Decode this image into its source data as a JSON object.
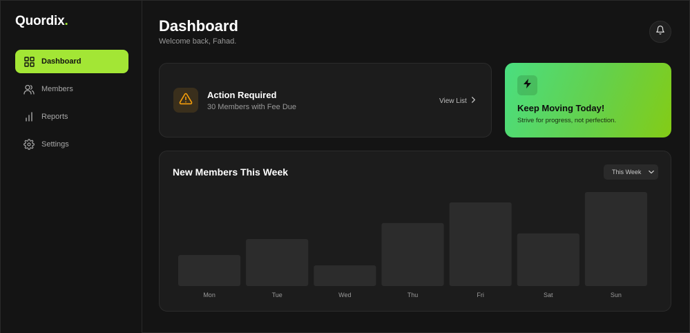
{
  "sidebar": {
    "logo": "Quordix",
    "logo_dot": ".",
    "items": [
      {
        "label": "Dashboard",
        "icon": "grid-icon",
        "active": true
      },
      {
        "label": "Members",
        "icon": "users-icon",
        "active": false
      },
      {
        "label": "Reports",
        "icon": "bar-chart-icon",
        "active": false
      },
      {
        "label": "Settings",
        "icon": "gear-icon",
        "active": false
      }
    ]
  },
  "header": {
    "title": "Dashboard",
    "subtitle": "Welcome back, Fahad.",
    "bell_icon": "bell-icon"
  },
  "action_card": {
    "title": "Action Required",
    "subtitle": "30 Members with Fee Due",
    "link": "View List",
    "icon": "warning-icon",
    "accent": "#f59e0b"
  },
  "motivation_card": {
    "title": "Keep Moving Today!",
    "subtitle": "Strive for progress, not perfection.",
    "icon": "bolt-icon"
  },
  "chart_card": {
    "title": "New Members This Week",
    "period": "This Week"
  },
  "chart_data": {
    "type": "bar",
    "categories": [
      "Mon",
      "Tue",
      "Wed",
      "Thu",
      "Fri",
      "Sat",
      "Sun"
    ],
    "values": [
      33,
      50,
      22,
      67,
      89,
      56,
      100
    ],
    "ylim": [
      0,
      100
    ],
    "grid": false,
    "bar_color": "#2c2c2c"
  },
  "colors": {
    "accent": "#a3e635",
    "background": "#141414",
    "card": "#1c1c1c"
  }
}
